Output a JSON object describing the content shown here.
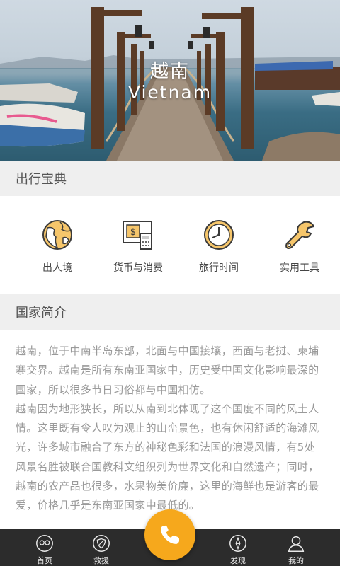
{
  "hero": {
    "title_cn": "越南",
    "title_en": "Vietnam",
    "image": "pier-over-water-photo"
  },
  "guide": {
    "heading": "出行宝典",
    "items": [
      {
        "label": "出人境",
        "icon": "globe-icon"
      },
      {
        "label": "货币与消费",
        "icon": "currency-icon"
      },
      {
        "label": "旅行时间",
        "icon": "clock-icon"
      },
      {
        "label": "实用工具",
        "icon": "wrench-icon"
      }
    ]
  },
  "intro": {
    "heading": "国家简介",
    "paragraphs": [
      "越南，位于中南半岛东部，北面与中国接壤，西面与老挝、柬埔寨交界。越南是所有东南亚国家中，历史受中国文化影响最深的国家，所以很多节日习俗都与中国相仿。",
      "越南因为地形狭长，所以从南到北体现了这个国度不同的风土人情。这里既有令人叹为观止的山峦景色，也有休闲舒适的海滩风光，许多城市融合了东方的神秘色彩和法国的浪漫风情，有5处风景名胜被联合国教科文组织列为世界文化和自然遗产；同时，越南的农产品也很多，水果物美价廉，这里的海鲜也是游客的最爱，价格几乎是东南亚国家中最低的。"
    ]
  },
  "nav": {
    "home": "首页",
    "rescue": "救援",
    "discover": "发现",
    "mine": "我的",
    "call_icon": "phone-icon"
  },
  "colors": {
    "accent": "#f6a81c",
    "section_bg": "#efefef",
    "nav_bg": "#2c2c2c",
    "body_text": "#9a9a9a"
  }
}
